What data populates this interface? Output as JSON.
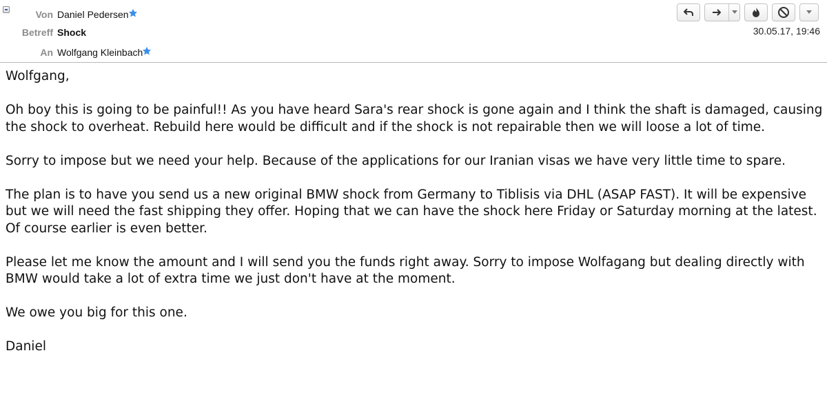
{
  "header": {
    "from_label": "Von",
    "from_value": "Daniel Pedersen",
    "subject_label": "Betreff",
    "subject_value": "Shock",
    "to_label": "An",
    "to_value": "Wolfgang Kleinbach",
    "timestamp": "30.05.17, 19:46"
  },
  "toolbar": {
    "reply_icon": "reply-arrow-icon",
    "forward_icon": "forward-arrow-icon",
    "flame_icon": "flame-icon",
    "junk_icon": "prohibited-icon",
    "more_icon": "chevron-down-icon"
  },
  "body": {
    "greeting": "Wolfgang,",
    "para1": "Oh boy this is going to be painful!!  As you have heard Sara's rear shock is gone again and I think the shaft is damaged, causing the shock to overheat.  Rebuild here would be difficult and if the shock is not repairable then we will loose a lot of time.",
    "para2": "Sorry to impose but we need your help.  Because of the applications for our Iranian visas we have very little time to spare.",
    "para3": "The plan is to have you send us a new original BMW shock from Germany to Tiblisis via DHL (ASAP FAST). It will be expensive but we will need the fast shipping they offer. Hoping that we can have the shock here Friday or Saturday morning at the latest. Of course earlier is even better.",
    "para4": "Please let me know the amount and I will send you the funds right away.  Sorry to impose Wolfagang but dealing directly with BMW would take a lot of extra time we just don't have at the moment.",
    "para5": "We owe you big for this one.",
    "signature": "Daniel"
  },
  "colors": {
    "label_gray": "#8c8c8c",
    "star_blue": "#3d8ee6",
    "separator": "#b8b8b8"
  }
}
